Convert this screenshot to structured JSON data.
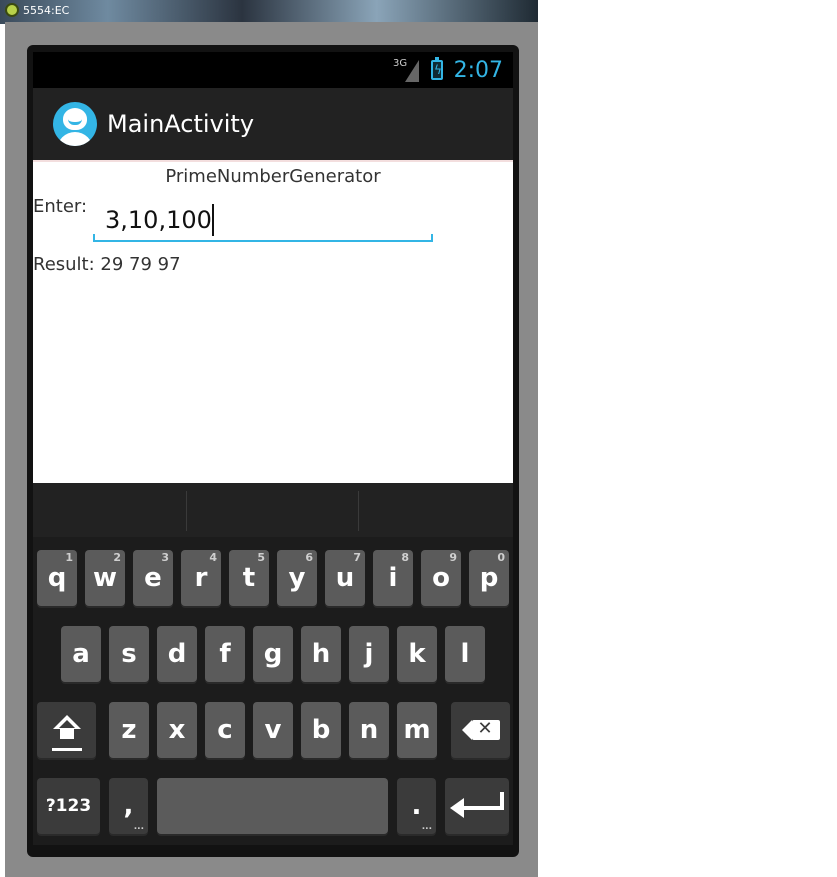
{
  "window": {
    "title": "5554:EC",
    "icon": "android-emulator-icon"
  },
  "status_bar": {
    "network": "3G",
    "time": "2:07"
  },
  "action_bar": {
    "title": "MainActivity",
    "logo": "app-launcher-icon"
  },
  "content": {
    "header": "PrimeNumberGenerator",
    "enter_label": "Enter:",
    "input_value": "3,10,100",
    "result_label": "Result:",
    "result_values": "29 79 97"
  },
  "keyboard": {
    "row1": [
      {
        "label": "q",
        "hint": "1"
      },
      {
        "label": "w",
        "hint": "2"
      },
      {
        "label": "e",
        "hint": "3"
      },
      {
        "label": "r",
        "hint": "4"
      },
      {
        "label": "t",
        "hint": "5"
      },
      {
        "label": "y",
        "hint": "6"
      },
      {
        "label": "u",
        "hint": "7"
      },
      {
        "label": "i",
        "hint": "8"
      },
      {
        "label": "o",
        "hint": "9"
      },
      {
        "label": "p",
        "hint": "0"
      }
    ],
    "row2": [
      "a",
      "s",
      "d",
      "f",
      "g",
      "h",
      "j",
      "k",
      "l"
    ],
    "row3": [
      "z",
      "x",
      "c",
      "v",
      "b",
      "n",
      "m"
    ],
    "symbols_label": "?123",
    "comma_label": ",",
    "period_label": ".",
    "ellipsis": "...",
    "shift_icon": "shift-icon",
    "backspace_icon": "backspace-icon",
    "enter_icon": "enter-icon"
  },
  "colors": {
    "accent": "#33b5e5",
    "action_bar": "#222222",
    "key": "#5b5b5b",
    "key_dark": "#3b3b3b"
  }
}
